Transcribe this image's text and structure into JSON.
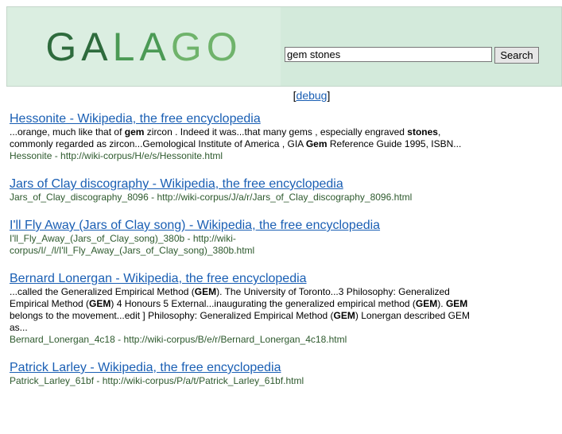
{
  "header": {
    "logo": {
      "part1": "GA",
      "part2": "LA",
      "part3": "GO"
    },
    "search": {
      "value": "gem stones",
      "button_label": "Search"
    }
  },
  "debug": {
    "open": "[",
    "label": "debug",
    "close": "]"
  },
  "results": [
    {
      "title": "Hessonite - Wikipedia, the free encyclopedia",
      "snippet_html": "...orange, much like that of <b>gem</b> zircon . Indeed it was...that many gems , especially engraved <b>stones</b>, commonly regarded as zircon...Gemological Institute of America , GIA <b>Gem</b> Reference Guide 1995, ISBN...",
      "url": "Hessonite - http://wiki-corpus/H/e/s/Hessonite.html"
    },
    {
      "title": "Jars of Clay discography - Wikipedia, the free encyclopedia",
      "snippet_html": "",
      "url": "Jars_of_Clay_discography_8096 - http://wiki-corpus/J/a/r/Jars_of_Clay_discography_8096.html"
    },
    {
      "title": "I'll Fly Away (Jars of Clay song) - Wikipedia, the free encyclopedia",
      "snippet_html": "",
      "url": "I'll_Fly_Away_(Jars_of_Clay_song)_380b - http://wiki-corpus/I/_/l/I'll_Fly_Away_(Jars_of_Clay_song)_380b.html"
    },
    {
      "title": "Bernard Lonergan - Wikipedia, the free encyclopedia",
      "snippet_html": "...called the Generalized Empirical Method (<b>GEM</b>). The University of Toronto...3 Philosophy: Generalized Empirical Method (<b>GEM</b>) 4 Honours 5 External...inaugurating the generalized empirical method (<b>GEM</b>). <b>GEM</b> belongs to the movement...edit ] Philosophy: Generalized Empirical Method (<b>GEM</b>) Lonergan described GEM as...",
      "url": "Bernard_Lonergan_4c18 - http://wiki-corpus/B/e/r/Bernard_Lonergan_4c18.html"
    },
    {
      "title": "Patrick Larley - Wikipedia, the free encyclopedia",
      "snippet_html": "",
      "url": "Patrick_Larley_61bf - http://wiki-corpus/P/a/t/Patrick_Larley_61bf.html"
    }
  ]
}
